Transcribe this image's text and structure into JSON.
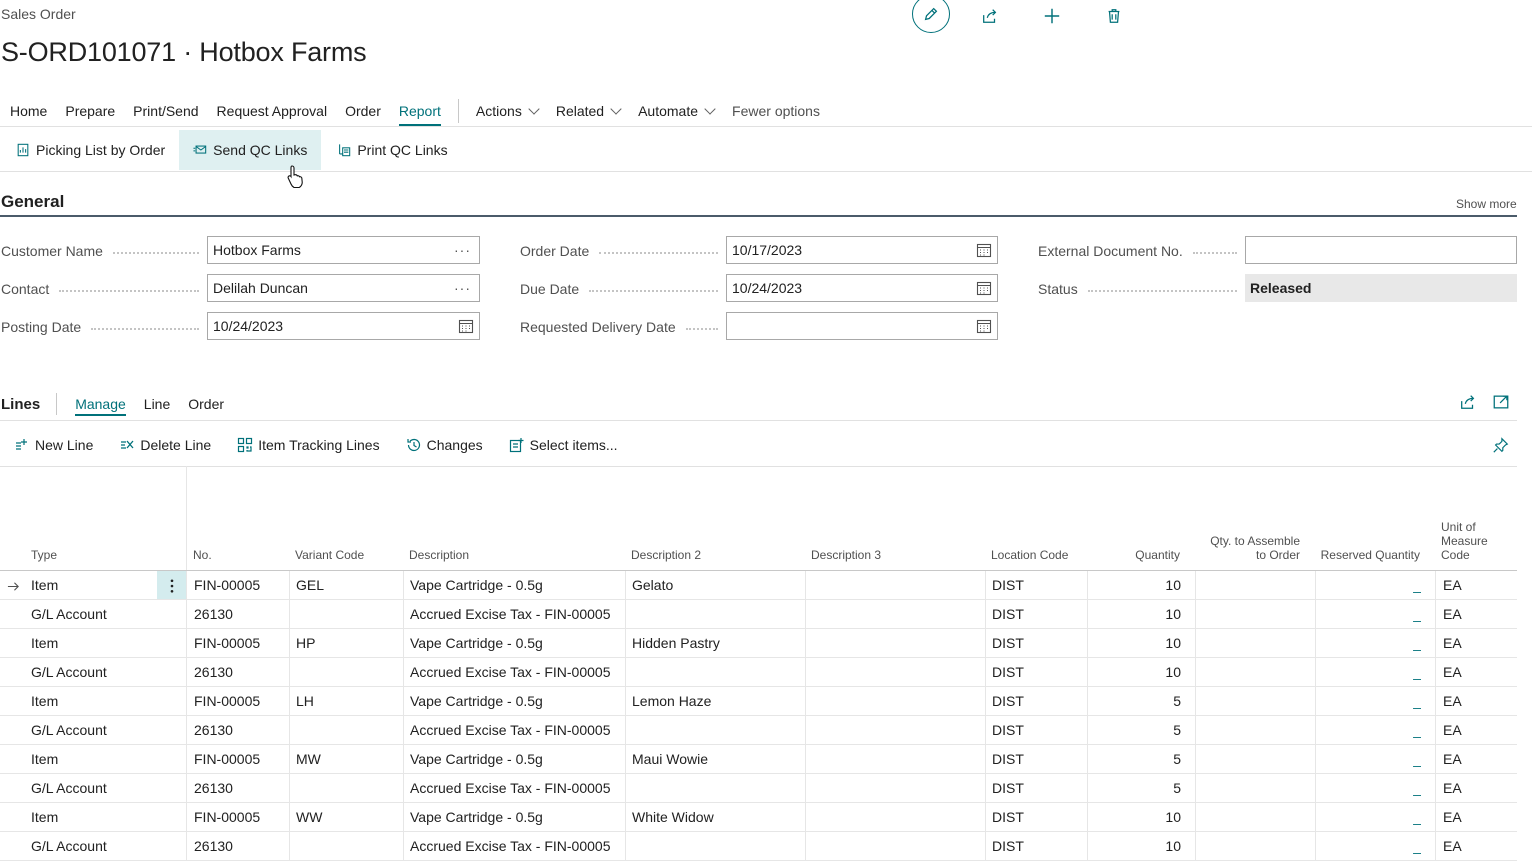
{
  "header": {
    "breadcrumb": "Sales Order",
    "title": "S-ORD101071 · Hotbox Farms",
    "icons": [
      "edit-icon",
      "share-icon",
      "add-icon",
      "delete-icon"
    ]
  },
  "actionbar": {
    "items": [
      {
        "label": "Home"
      },
      {
        "label": "Prepare"
      },
      {
        "label": "Print/Send"
      },
      {
        "label": "Request Approval"
      },
      {
        "label": "Order"
      },
      {
        "label": "Report"
      }
    ],
    "active": "Report",
    "menus": [
      {
        "label": "Actions"
      },
      {
        "label": "Related"
      },
      {
        "label": "Automate"
      }
    ],
    "fewer_options": "Fewer options"
  },
  "subbar": {
    "items": [
      {
        "label": "Picking List by Order",
        "icon": "report-icon"
      },
      {
        "label": "Send QC Links",
        "icon": "send-icon"
      },
      {
        "label": "Print QC Links",
        "icon": "print-icon"
      }
    ]
  },
  "general": {
    "title": "General",
    "show_more": "Show more",
    "fields": {
      "customer_name": {
        "label": "Customer Name",
        "value": "Hotbox Farms"
      },
      "contact": {
        "label": "Contact",
        "value": "Delilah Duncan"
      },
      "posting_date": {
        "label": "Posting Date",
        "value": "10/24/2023"
      },
      "order_date": {
        "label": "Order Date",
        "value": "10/17/2023"
      },
      "due_date": {
        "label": "Due Date",
        "value": "10/24/2023"
      },
      "requested_delivery_date": {
        "label": "Requested Delivery Date",
        "value": ""
      },
      "external_document_no": {
        "label": "External Document No.",
        "value": ""
      },
      "status": {
        "label": "Status",
        "value": "Released"
      }
    }
  },
  "lines": {
    "title": "Lines",
    "tabs": [
      {
        "label": "Manage"
      },
      {
        "label": "Line"
      },
      {
        "label": "Order"
      }
    ],
    "actions": [
      {
        "label": "New Line"
      },
      {
        "label": "Delete Line"
      },
      {
        "label": "Item Tracking Lines"
      },
      {
        "label": "Changes"
      },
      {
        "label": "Select items..."
      }
    ],
    "columns": {
      "type": "Type",
      "no": "No.",
      "variant": "Variant Code",
      "desc": "Description",
      "desc2": "Description 2",
      "desc3": "Description 3",
      "location": "Location Code",
      "qty": "Quantity",
      "qty_assemble_1": "Qty. to Assemble",
      "qty_assemble_2": "to Order",
      "reserved": "Reserved Quantity",
      "uom_1": "Unit of",
      "uom_2": "Measure Code"
    },
    "rows": [
      {
        "type": "Item",
        "no": "FIN-00005",
        "variant": "GEL",
        "desc": "Vape Cartridge - 0.5g",
        "desc2": "Gelato",
        "location": "DIST",
        "qty": "10",
        "reserved": "_",
        "uom": "EA"
      },
      {
        "type": "G/L Account",
        "no": "26130",
        "variant": "",
        "desc": "Accrued Excise Tax  - FIN-00005",
        "desc2": "",
        "location": "DIST",
        "qty": "10",
        "reserved": "_",
        "uom": "EA"
      },
      {
        "type": "Item",
        "no": "FIN-00005",
        "variant": "HP",
        "desc": "Vape Cartridge - 0.5g",
        "desc2": "Hidden Pastry",
        "location": "DIST",
        "qty": "10",
        "reserved": "_",
        "uom": "EA"
      },
      {
        "type": "G/L Account",
        "no": "26130",
        "variant": "",
        "desc": "Accrued Excise Tax  - FIN-00005",
        "desc2": "",
        "location": "DIST",
        "qty": "10",
        "reserved": "_",
        "uom": "EA"
      },
      {
        "type": "Item",
        "no": "FIN-00005",
        "variant": "LH",
        "desc": "Vape Cartridge - 0.5g",
        "desc2": "Lemon Haze",
        "location": "DIST",
        "qty": "5",
        "reserved": "_",
        "uom": "EA"
      },
      {
        "type": "G/L Account",
        "no": "26130",
        "variant": "",
        "desc": "Accrued Excise Tax  - FIN-00005",
        "desc2": "",
        "location": "DIST",
        "qty": "5",
        "reserved": "_",
        "uom": "EA"
      },
      {
        "type": "Item",
        "no": "FIN-00005",
        "variant": "MW",
        "desc": "Vape Cartridge - 0.5g",
        "desc2": "Maui Wowie",
        "location": "DIST",
        "qty": "5",
        "reserved": "_",
        "uom": "EA"
      },
      {
        "type": "G/L Account",
        "no": "26130",
        "variant": "",
        "desc": "Accrued Excise Tax  - FIN-00005",
        "desc2": "",
        "location": "DIST",
        "qty": "5",
        "reserved": "_",
        "uom": "EA"
      },
      {
        "type": "Item",
        "no": "FIN-00005",
        "variant": "WW",
        "desc": "Vape Cartridge - 0.5g",
        "desc2": "White Widow",
        "location": "DIST",
        "qty": "10",
        "reserved": "_",
        "uom": "EA"
      },
      {
        "type": "G/L Account",
        "no": "26130",
        "variant": "",
        "desc": "Accrued Excise Tax  - FIN-00005",
        "desc2": "",
        "location": "DIST",
        "qty": "10",
        "reserved": "_",
        "uom": "EA"
      }
    ]
  }
}
